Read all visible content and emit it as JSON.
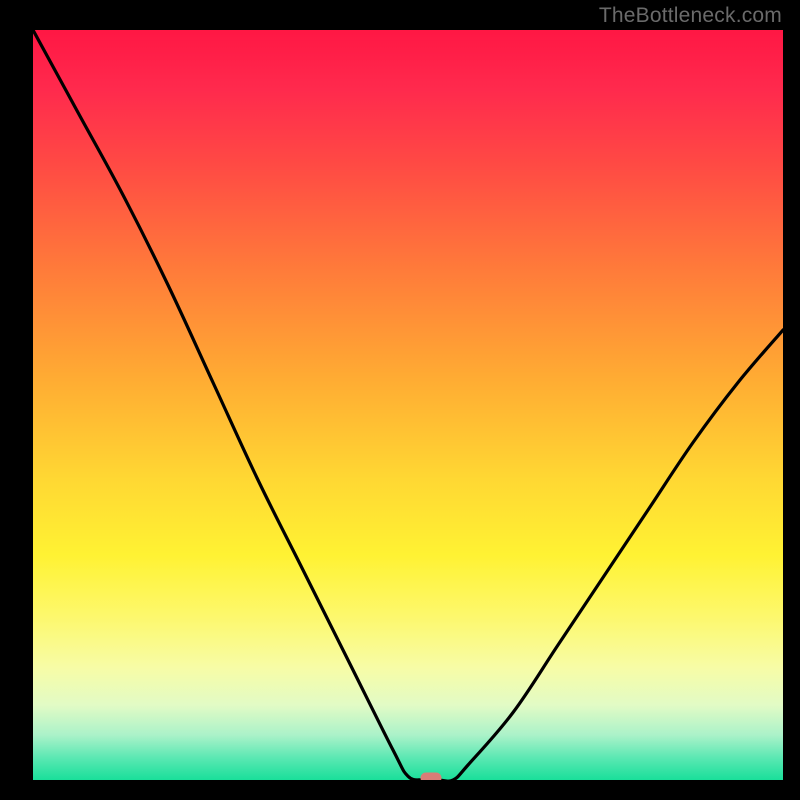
{
  "watermark": "TheBottleneck.com",
  "colors": {
    "frame": "#000000",
    "marker": "#da7d77",
    "curve": "#000000"
  },
  "chart_data": {
    "type": "line",
    "title": "",
    "xlabel": "",
    "ylabel": "",
    "xlim": [
      0,
      100
    ],
    "ylim": [
      0,
      100
    ],
    "grid": false,
    "series": [
      {
        "name": "bottleneck-curve",
        "x": [
          0,
          6,
          12,
          18,
          24,
          30,
          36,
          42,
          48,
          50,
          52,
          54,
          56,
          58,
          64,
          70,
          76,
          82,
          88,
          94,
          100
        ],
        "y": [
          100,
          89,
          78,
          66,
          53,
          40,
          28,
          16,
          4,
          0.5,
          0,
          0,
          0,
          2,
          9,
          18,
          27,
          36,
          45,
          53,
          60
        ]
      }
    ],
    "marker": {
      "x": 53,
      "y": 0.3
    },
    "legend": false
  }
}
